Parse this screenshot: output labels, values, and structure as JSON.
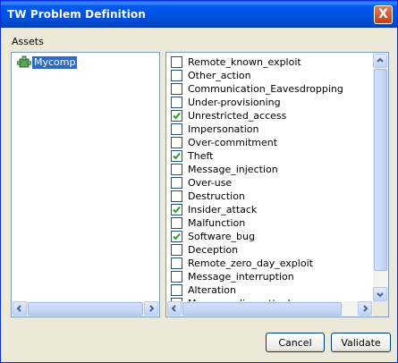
{
  "window": {
    "title": "TW Problem Definition",
    "close_label": "X"
  },
  "assets": {
    "label": "Assets",
    "tree_items": [
      {
        "label": "Mycomp",
        "selected": true
      }
    ]
  },
  "problems": [
    {
      "label": "Remote_known_exploit",
      "checked": false
    },
    {
      "label": "Other_action",
      "checked": false
    },
    {
      "label": "Communication_Eavesdropping",
      "checked": false
    },
    {
      "label": "Under-provisioning",
      "checked": false
    },
    {
      "label": "Unrestricted_access",
      "checked": true
    },
    {
      "label": "Impersonation",
      "checked": false
    },
    {
      "label": "Over-commitment",
      "checked": false
    },
    {
      "label": "Theft",
      "checked": true
    },
    {
      "label": "Message_injection",
      "checked": false
    },
    {
      "label": "Over-use",
      "checked": false
    },
    {
      "label": "Destruction",
      "checked": false
    },
    {
      "label": "Insider_attack",
      "checked": true
    },
    {
      "label": "Malfunction",
      "checked": false
    },
    {
      "label": "Software_bug",
      "checked": true
    },
    {
      "label": "Deception",
      "checked": false
    },
    {
      "label": "Remote_zero_day_exploit",
      "checked": false
    },
    {
      "label": "Message_interruption",
      "checked": false
    },
    {
      "label": "Alteration",
      "checked": false
    },
    {
      "label": "Masquerading_attack",
      "checked": false
    }
  ],
  "buttons": {
    "cancel": "Cancel",
    "validate": "Validate"
  },
  "colors": {
    "title_bar": "#0054E3",
    "selection": "#316AC5",
    "check": "#21A121",
    "panel_border": "#7F9DB9"
  }
}
